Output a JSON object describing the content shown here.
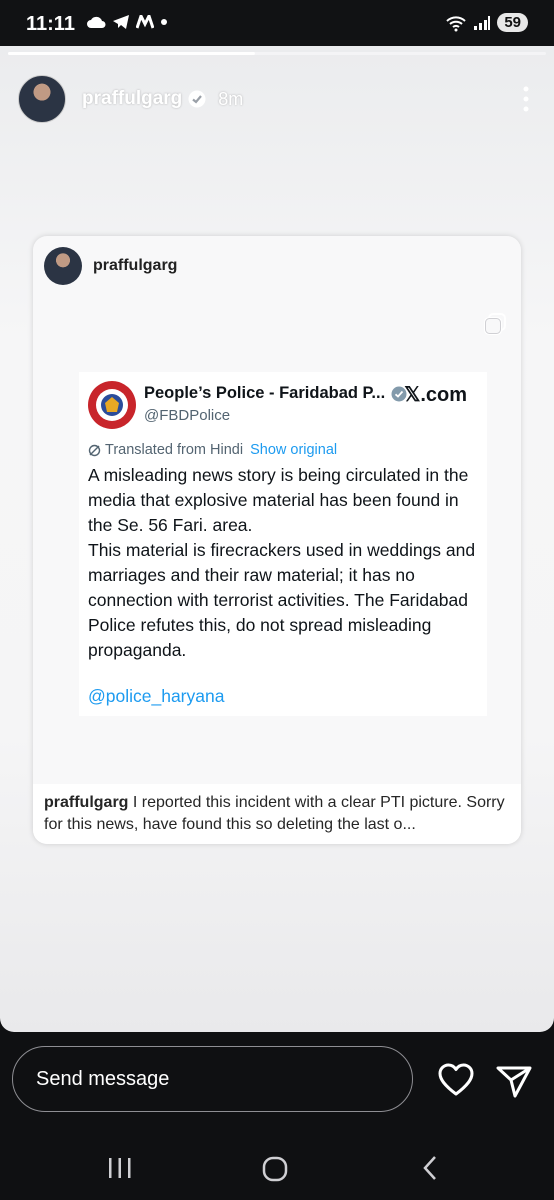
{
  "status_bar": {
    "time": "11:11",
    "left_icons": [
      "cloud-icon",
      "telegram-icon",
      "m-app-icon",
      "dot-icon"
    ],
    "right_icons": [
      "wifi-icon",
      "signal-icon"
    ],
    "battery": "59"
  },
  "story": {
    "progress_fraction": 0.46,
    "username": "praffulgarg",
    "verified": true,
    "time_ago": "8m"
  },
  "shared_post": {
    "username": "praffulgarg",
    "caption_user": "praffulgarg",
    "caption_text": "I reported this incident with a clear PTI picture. Sorry for this news, have found this so deleting the last o..."
  },
  "tweet": {
    "display_name": "People’s Police - Faridabad P...",
    "handle": "@FBDPolice",
    "site": "𝕏.com",
    "translated_label": "Translated from Hindi",
    "show_original": "Show original",
    "body": "A misleading news story is being circulated in the media that explosive material has been found in the Se. 56 Fari. area.\nThis material is firecrackers used in weddings and marriages and their raw material; it has no connection with terrorist activities. The Faridabad Police refutes this, do not spread misleading propaganda.",
    "mention": "@police_haryana"
  },
  "reply_bar": {
    "placeholder": "Send message"
  },
  "colors": {
    "link_blue": "#1d9bf0",
    "verified_blue": "#3897f0",
    "police_red": "#c8252b"
  }
}
